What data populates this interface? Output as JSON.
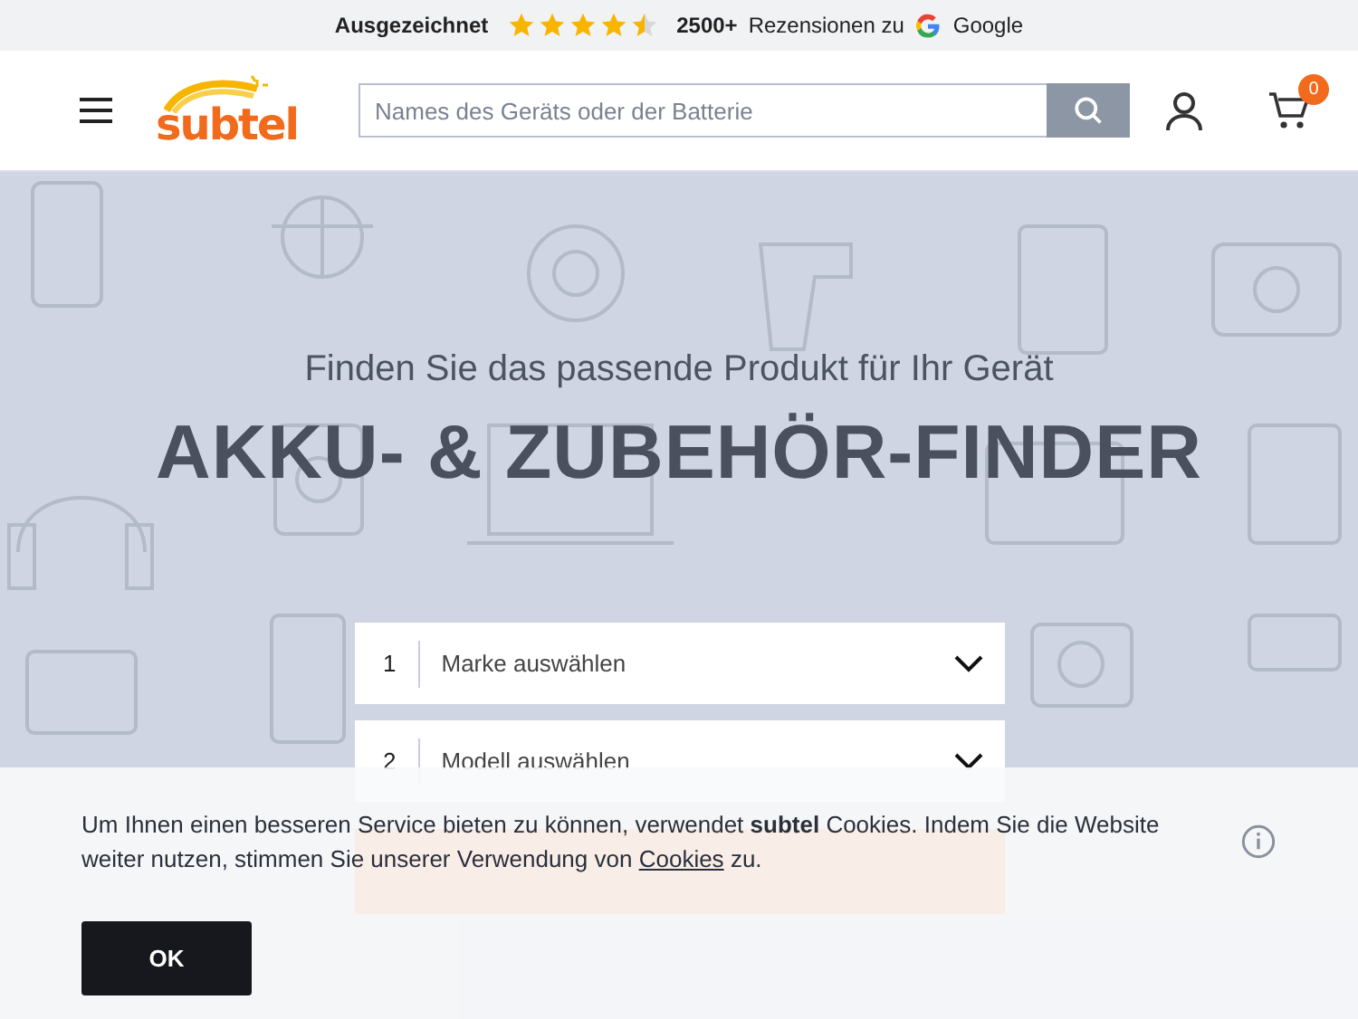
{
  "rating_bar": {
    "label": "Ausgezeichnet",
    "stars": 4.5,
    "count": "2500+",
    "text": "Rezensionen zu",
    "brand": "Google"
  },
  "header": {
    "logo": "subtel",
    "search": {
      "placeholder": "Names des Geräts oder der Batterie"
    },
    "cart_count": "0"
  },
  "hero": {
    "subtitle": "Finden Sie das passende Produkt für Ihr Gerät",
    "title": "AKKU- & ZUBEHÖR-FINDER",
    "selects": [
      {
        "number": "1",
        "label": "Marke auswählen"
      },
      {
        "number": "2",
        "label": "Modell auswählen"
      }
    ]
  },
  "cookie_banner": {
    "text": "Um Ihnen einen besseren Service bieten zu können, verwendet **subtel** Cookies. Indem Sie die Website weiter nutzen, stimmen Sie unserer Verwendung von",
    "link": "Cookies",
    "text_end": "zu.",
    "button": "OK"
  }
}
